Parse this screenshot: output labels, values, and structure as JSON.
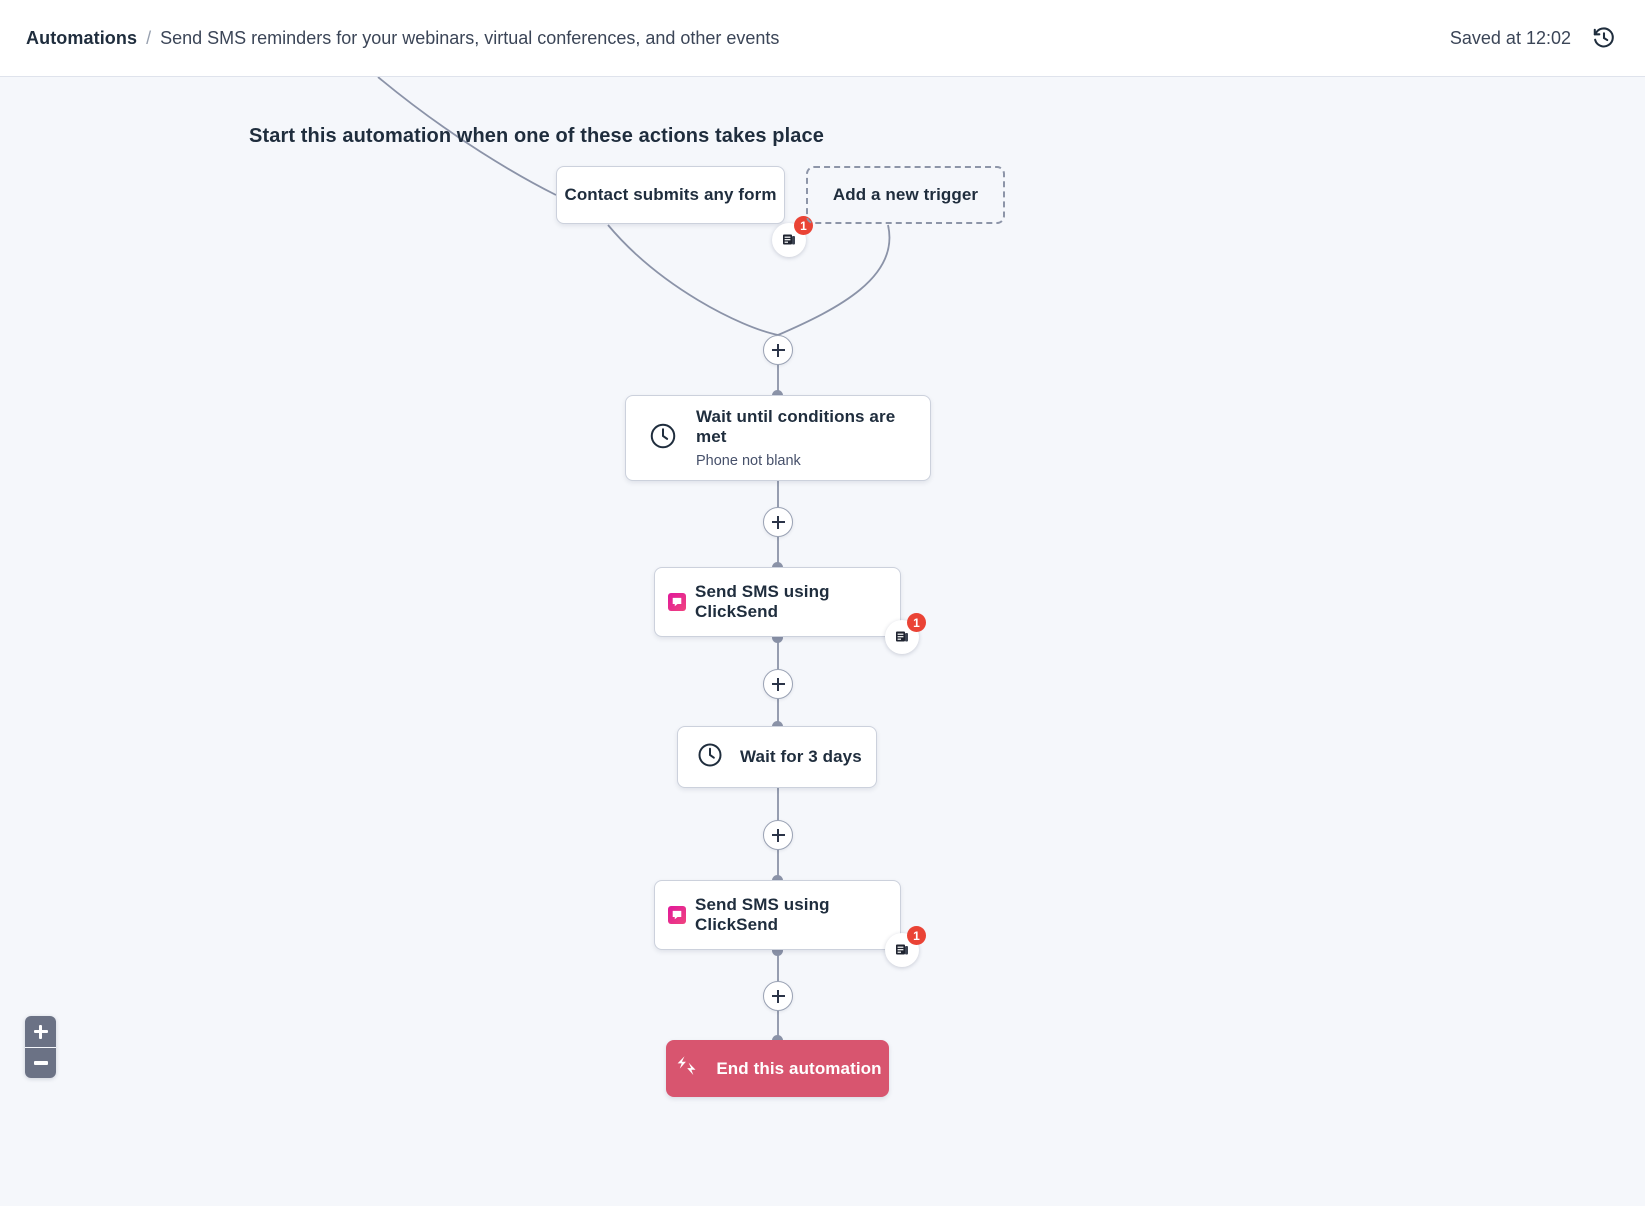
{
  "header": {
    "breadcrumb_root": "Automations",
    "breadcrumb_separator": "/",
    "breadcrumb_current": "Send SMS reminders for your webinars, virtual conferences, and other events",
    "saved_status": "Saved at 12:02",
    "history_icon": "history-clock-arrow-icon"
  },
  "canvas": {
    "section_title": "Start this automation when one of these actions takes place",
    "background_color": "#f5f7fb",
    "edge_color": "#8b93a8"
  },
  "triggers": [
    {
      "label": "Contact submits any form",
      "badge_count": "1",
      "badge_icon": "note-icon"
    },
    {
      "label": "Add a new trigger",
      "style": "dashed"
    }
  ],
  "steps": [
    {
      "type": "wait-conditions",
      "icon": "clock-icon",
      "label": "Wait until conditions are met",
      "sublabel": "Phone not blank"
    },
    {
      "type": "send-sms",
      "icon": "clicksend-icon",
      "label": "Send SMS using ClickSend",
      "badge_count": "1",
      "badge_icon": "note-icon"
    },
    {
      "type": "wait-delay",
      "icon": "clock-icon",
      "label": "Wait for 3 days"
    },
    {
      "type": "send-sms",
      "icon": "clicksend-icon",
      "label": "Send SMS using ClickSend",
      "badge_count": "1",
      "badge_icon": "note-icon"
    }
  ],
  "end_node": {
    "label": "End this automation",
    "icon": "end-arrows-icon",
    "color": "#d8556f"
  },
  "zoom_controls": {
    "zoom_in_label": "+",
    "zoom_out_label": "−"
  },
  "add_step_label": "+"
}
